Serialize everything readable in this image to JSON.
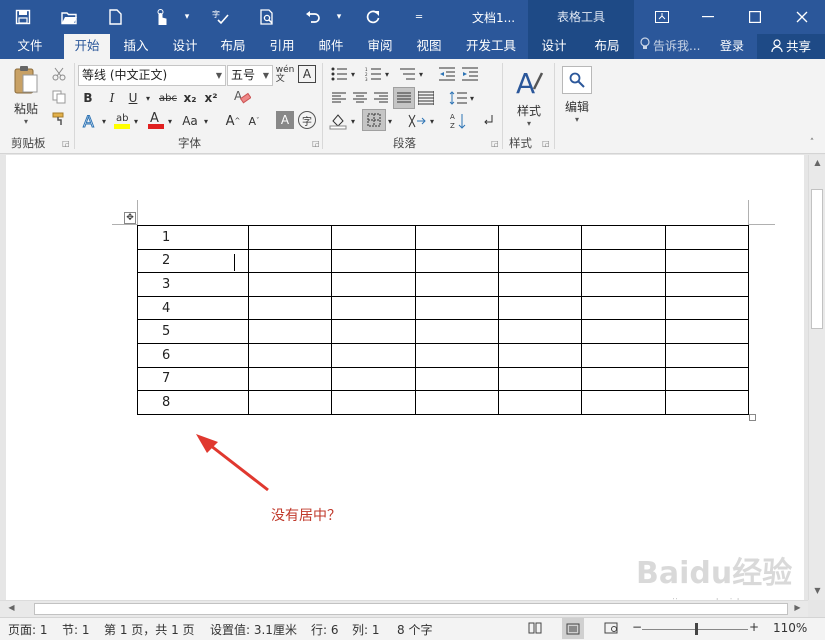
{
  "title_bar": {
    "doc_title": "文档1...",
    "context_title": "表格工具",
    "qat": [
      "save-icon",
      "open-icon",
      "new-icon",
      "touch-mode-icon",
      "spelling-icon",
      "print-preview-icon",
      "undo-icon",
      "redo-icon",
      "customize-icon"
    ]
  },
  "tabs": {
    "file": "文件",
    "home": "开始",
    "insert": "插入",
    "design": "设计",
    "layout": "布局",
    "references": "引用",
    "mailings": "邮件",
    "review": "审阅",
    "view": "视图",
    "developer": "开发工具",
    "table_design": "设计",
    "table_layout": "布局",
    "tell_me": "告诉我...",
    "login": "登录",
    "share": "共享"
  },
  "ribbon": {
    "clipboard": {
      "paste": "粘贴",
      "label": "剪贴板"
    },
    "font": {
      "font_name": "等线 (中文正文)",
      "font_size": "五号",
      "bold": "B",
      "italic": "I",
      "underline": "U",
      "strike": "abc",
      "subscript": "x₂",
      "superscript": "x²",
      "label": "字体"
    },
    "paragraph": {
      "label": "段落"
    },
    "styles": {
      "button": "样式",
      "label": "样式"
    },
    "editing": {
      "button": "编辑"
    }
  },
  "document": {
    "rows": [
      [
        "1",
        "",
        "",
        "",
        "",
        "",
        ""
      ],
      [
        "2",
        "",
        "",
        "",
        "",
        "",
        ""
      ],
      [
        "3",
        "",
        "",
        "",
        "",
        "",
        ""
      ],
      [
        "4",
        "",
        "",
        "",
        "",
        "",
        ""
      ],
      [
        "5",
        "",
        "",
        "",
        "",
        "",
        ""
      ],
      [
        "6",
        "",
        "",
        "",
        "",
        "",
        ""
      ],
      [
        "7",
        "",
        "",
        "",
        "",
        "",
        ""
      ],
      [
        "8",
        "",
        "",
        "",
        "",
        "",
        ""
      ]
    ],
    "annotation": "没有居中？"
  },
  "status_bar": {
    "page": "页面: 1",
    "section": "节: 1",
    "page_of": "第 1 页，共 1 页",
    "position": "设置值: 3.1厘米",
    "line": "行: 6",
    "column": "列: 1",
    "words": "8 个字",
    "zoom": "110%"
  },
  "watermark": {
    "main": "Baidu经验",
    "url": "jingyan.baidu.com"
  },
  "colors": {
    "brand": "#2b579a",
    "annotation": "#e0382f"
  }
}
